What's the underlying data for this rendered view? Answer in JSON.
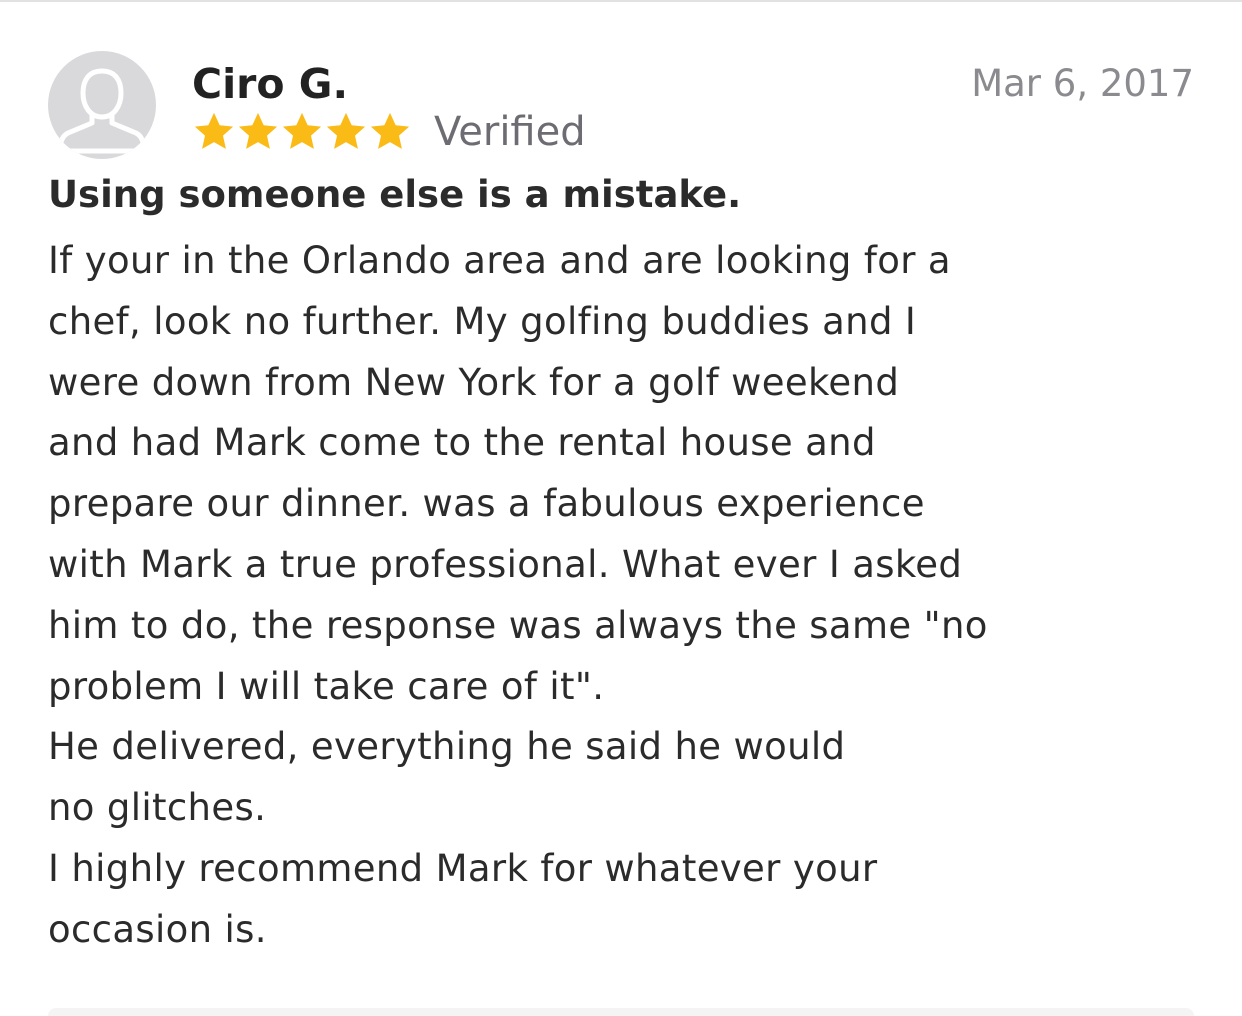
{
  "review": {
    "reviewer_name": "Ciro G.",
    "date": "Mar 6, 2017",
    "rating": 5,
    "rating_max": 5,
    "verified_label": "Verified",
    "title": "Using someone else is a mistake.",
    "body_lines": [
      "If your in the Orlando area and are looking for a",
      "chef, look no further. My golfing buddies and I",
      "were down from New York for a golf weekend",
      "and had Mark come to the rental house and",
      "prepare our dinner. was a fabulous experience",
      "with Mark a true professional. What ever I asked",
      "him to do, the response was always the same \"no",
      "problem I will take care of it\".",
      "He delivered, everything he said he would",
      "no glitches.",
      "I highly recommend Mark for whatever your",
      "occasion is."
    ]
  },
  "icons": {
    "avatar": "default-user-avatar-icon",
    "star": "star-icon"
  },
  "colors": {
    "star": "#FBBB16",
    "avatar_bg": "#D9D9DC",
    "avatar_figure": "#FFFFFF",
    "date_text": "#8A8A8F",
    "verified_text": "#6C6C72",
    "body_text": "#2B2B2B"
  }
}
